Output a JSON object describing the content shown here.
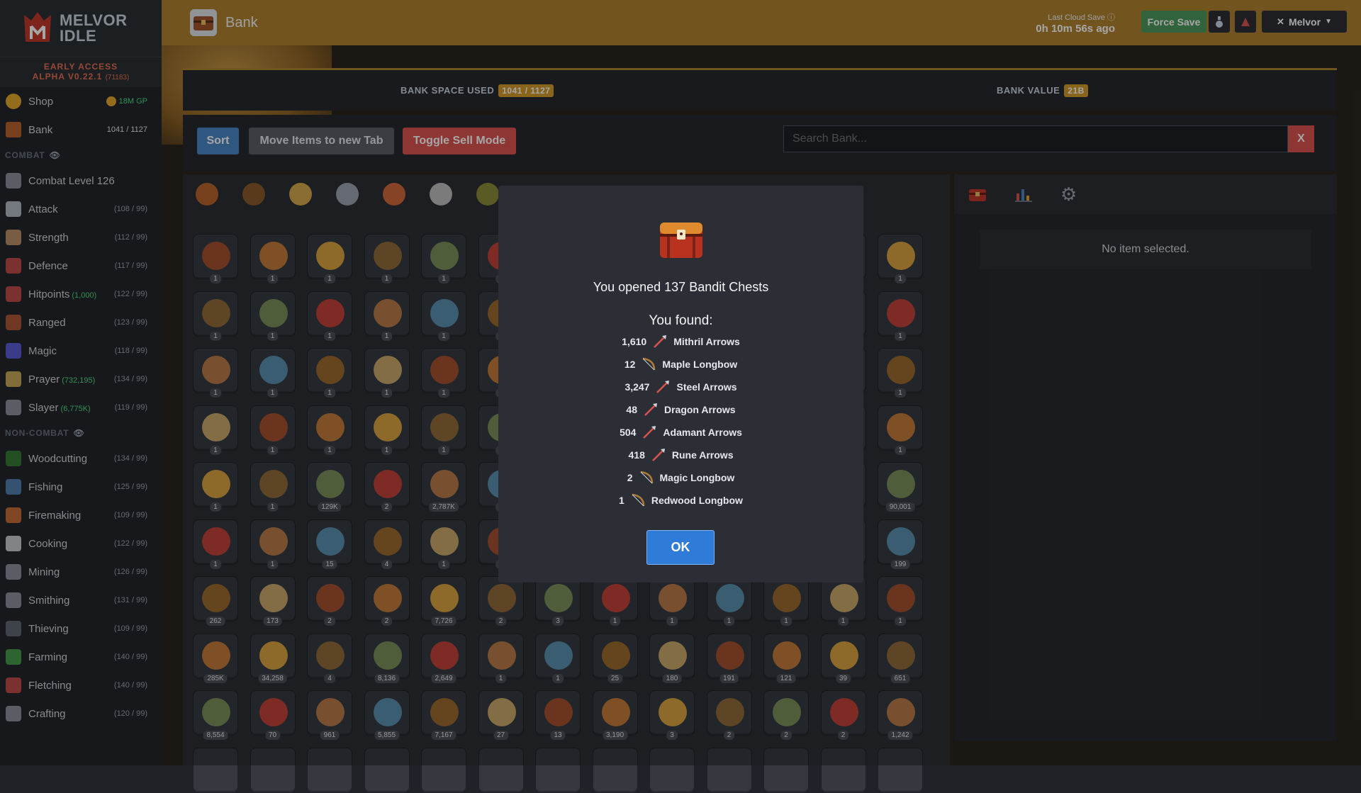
{
  "app": {
    "brand_line1": "MELVOR",
    "brand_line2": "IDLE",
    "edition": "EARLY ACCESS",
    "version": "ALPHA V0.22.1",
    "build": "(71183)"
  },
  "sidebar": {
    "top": [
      {
        "label": "Shop",
        "right": "18M GP"
      },
      {
        "label": "Bank",
        "right": "1041 / 1127"
      }
    ],
    "combat_header": "COMBAT",
    "combat": [
      {
        "label": "Combat Level 126",
        "sub": "",
        "level": ""
      },
      {
        "label": "Attack",
        "sub": "",
        "level": "(108 / 99)"
      },
      {
        "label": "Strength",
        "sub": "",
        "level": "(112 / 99)"
      },
      {
        "label": "Defence",
        "sub": "",
        "level": "(117 / 99)"
      },
      {
        "label": "Hitpoints",
        "sub": "(1,000)",
        "level": "(122 / 99)"
      },
      {
        "label": "Ranged",
        "sub": "",
        "level": "(123 / 99)"
      },
      {
        "label": "Magic",
        "sub": "",
        "level": "(118 / 99)"
      },
      {
        "label": "Prayer",
        "sub": "(732,195)",
        "level": "(134 / 99)"
      },
      {
        "label": "Slayer",
        "sub": "(6,775K)",
        "level": "(119 / 99)"
      }
    ],
    "noncombat_header": "NON-COMBAT",
    "noncombat": [
      {
        "label": "Woodcutting",
        "level": "(134 / 99)"
      },
      {
        "label": "Fishing",
        "level": "(125 / 99)"
      },
      {
        "label": "Firemaking",
        "level": "(109 / 99)"
      },
      {
        "label": "Cooking",
        "level": "(122 / 99)"
      },
      {
        "label": "Mining",
        "level": "(126 / 99)"
      },
      {
        "label": "Smithing",
        "level": "(131 / 99)"
      },
      {
        "label": "Thieving",
        "level": "(109 / 99)"
      },
      {
        "label": "Farming",
        "level": "(140 / 99)"
      },
      {
        "label": "Fletching",
        "level": "(140 / 99)"
      },
      {
        "label": "Crafting",
        "level": "(120 / 99)"
      }
    ]
  },
  "header": {
    "title": "Bank",
    "cloud_label": "Last Cloud Save",
    "cloud_time": "0h 10m 56s ago",
    "force_save": "Force Save",
    "user": "Melvor"
  },
  "bank": {
    "space_label": "BANK SPACE USED",
    "space_value": "1041 / 1127",
    "value_label": "BANK VALUE",
    "value_value": "21B",
    "sort": "Sort",
    "move": "Move Items to new Tab",
    "sell": "Toggle Sell Mode",
    "search_placeholder": "Search Bank...",
    "search_clear": "X",
    "no_item": "No item selected."
  },
  "grid_qty": [
    [
      "1",
      "1",
      "1",
      "1",
      "1",
      "1",
      "",
      "",
      "",
      "",
      "",
      "",
      "1"
    ],
    [
      "1",
      "1",
      "1",
      "1",
      "1",
      "1",
      "",
      "",
      "",
      "",
      "",
      "",
      "1"
    ],
    [
      "1",
      "1",
      "1",
      "1",
      "1",
      "1",
      "",
      "",
      "",
      "",
      "",
      "",
      "1"
    ],
    [
      "1",
      "1",
      "1",
      "1",
      "1",
      "1",
      "",
      "",
      "",
      "",
      "",
      "",
      "1"
    ],
    [
      "1",
      "1",
      "129K",
      "2",
      "2,787K",
      "1",
      "",
      "",
      "",
      "",
      "",
      "",
      "90,001"
    ],
    [
      "1",
      "1",
      "15",
      "4",
      "1",
      "1",
      "",
      "",
      "",
      "",
      "",
      "",
      "199"
    ],
    [
      "262",
      "173",
      "2",
      "2",
      "7,726",
      "2",
      "3",
      "1",
      "1",
      "1",
      "1",
      "1",
      "1"
    ],
    [
      "285K",
      "34,258",
      "4",
      "8,136",
      "2,649",
      "1",
      "1",
      "25",
      "180",
      "191",
      "121",
      "39",
      "651"
    ],
    [
      "8,554",
      "70",
      "961",
      "5,855",
      "7,167",
      "27",
      "13",
      "3,190",
      "3",
      "2",
      "2",
      "2",
      "1,242"
    ]
  ],
  "modal": {
    "title": "You opened 137 Bandit Chests",
    "found": "You found:",
    "drops": [
      {
        "qty": "1,610",
        "name": "Mithril Arrows",
        "icon": "arrow-icon"
      },
      {
        "qty": "12",
        "name": "Maple Longbow",
        "icon": "bow-icon"
      },
      {
        "qty": "3,247",
        "name": "Steel Arrows",
        "icon": "arrow-icon"
      },
      {
        "qty": "48",
        "name": "Dragon Arrows",
        "icon": "arrow-icon"
      },
      {
        "qty": "504",
        "name": "Adamant Arrows",
        "icon": "arrow-icon"
      },
      {
        "qty": "418",
        "name": "Rune Arrows",
        "icon": "arrow-icon"
      },
      {
        "qty": "2",
        "name": "Magic Longbow",
        "icon": "bow-icon"
      },
      {
        "qty": "1",
        "name": "Redwood Longbow",
        "icon": "bow-icon"
      }
    ],
    "ok": "OK"
  },
  "colors": {
    "header": "#b0832f",
    "gold": "#d39a2a",
    "primary": "#2f7bd8",
    "danger": "#d9534f",
    "success": "#4c9a5c"
  }
}
